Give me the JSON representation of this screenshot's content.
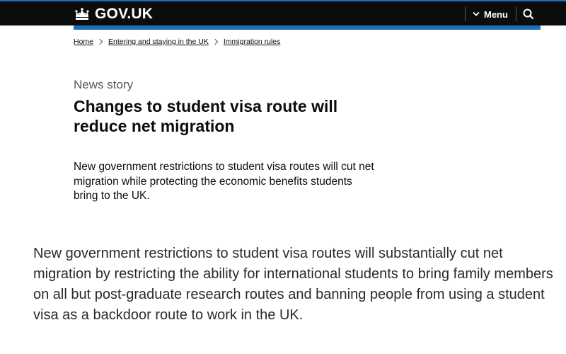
{
  "header": {
    "logo_text": "GOV.UK",
    "menu_label": "Menu",
    "icons": {
      "logo": "crown-icon",
      "menu": "chevron-down-icon",
      "search": "search-icon"
    }
  },
  "breadcrumbs": [
    {
      "label": "Home"
    },
    {
      "label": "Entering and staying in the UK"
    },
    {
      "label": "Immigration rules"
    }
  ],
  "page": {
    "caption": "News story",
    "title": "Changes to student visa route will reduce net migration",
    "lead": "New government restrictions to student visa routes will cut net migration while protecting the economic benefits students bring to the UK.",
    "body": "New government restrictions to student visa routes will substantially cut net migration by restricting the ability for international students to bring family members on all but post-graduate research routes and banning people from using a student visa as a backdoor route to work in the UK."
  },
  "colors": {
    "header_bg": "#0b0c0c",
    "brand_blue": "#1d70b8",
    "text": "#0b0c0c",
    "secondary_text": "#505a5f"
  }
}
